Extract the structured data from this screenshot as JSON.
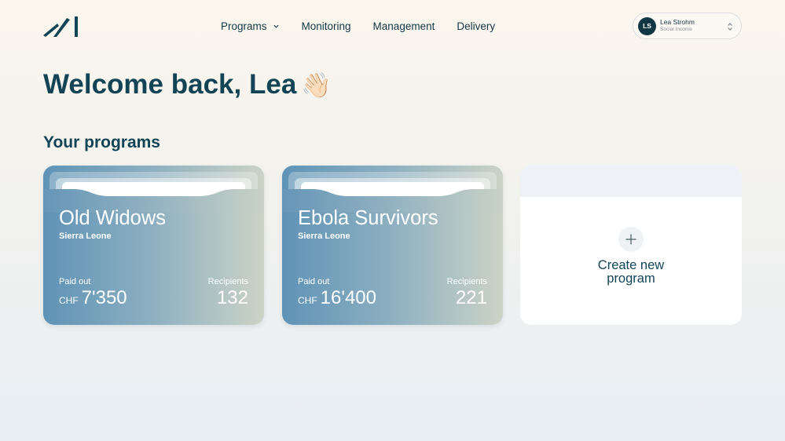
{
  "header": {
    "logo_icon": "brand-logo-icon",
    "nav": [
      {
        "label": "Programs",
        "has_dropdown": true
      },
      {
        "label": "Monitoring"
      },
      {
        "label": "Management"
      },
      {
        "label": "Delivery"
      }
    ],
    "user": {
      "initials": "LS",
      "name": "Lea Strohm",
      "organization": "Social Income",
      "switch_icon": "chevron-up-down-icon"
    }
  },
  "main": {
    "welcome": "Welcome back, Lea",
    "wave_emoji": "👋🏻",
    "section_title": "Your programs",
    "programs": [
      {
        "name": "Old Widows",
        "country": "Sierra Leone",
        "paid_out_label": "Paid out",
        "currency": "CHF",
        "paid_out": "7'350",
        "recipients_label": "Recipients",
        "recipients": "132"
      },
      {
        "name": "Ebola Survivors",
        "country": "Sierra Leone",
        "paid_out_label": "Paid out",
        "currency": "CHF",
        "paid_out": "16'400",
        "recipients_label": "Recipients",
        "recipients": "221"
      }
    ],
    "create_new": {
      "label_line1": "Create new",
      "label_line2": "program",
      "icon": "plus-icon"
    }
  },
  "colors": {
    "brand": "#124455",
    "card_gradient_start": "#5f93b6",
    "card_gradient_end": "#ccd3c6"
  }
}
